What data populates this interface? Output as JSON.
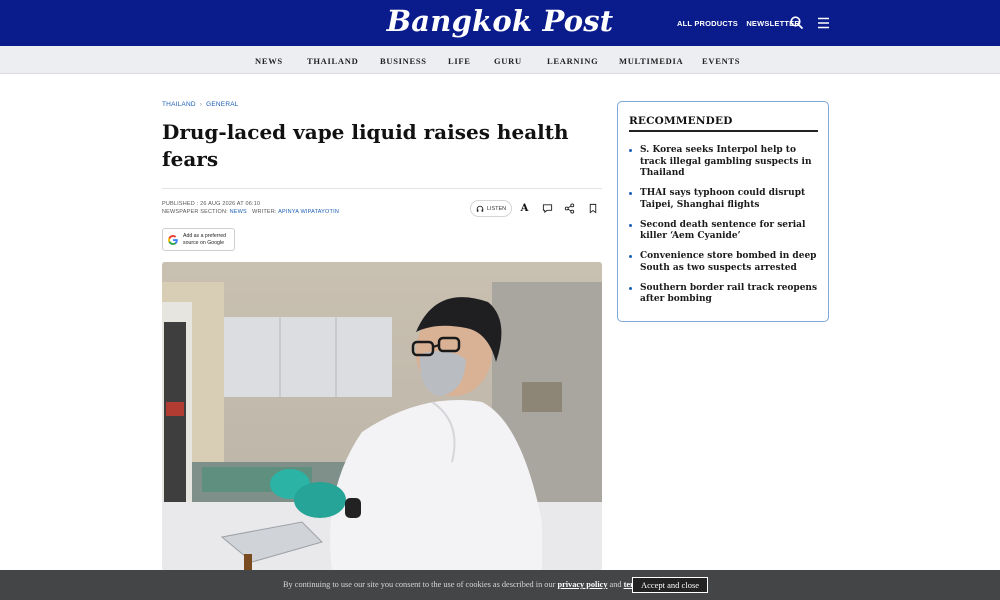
{
  "header": {
    "logo": "Bangkok Post",
    "all_products": "ALL PRODUCTS",
    "newsletter": "NEWSLETTER",
    "icons": [
      "search-icon",
      "menu-icon"
    ]
  },
  "nav": [
    "NEWS",
    "THAILAND",
    "BUSINESS",
    "LIFE",
    "GURU",
    "LEARNING",
    "MULTIMEDIA",
    "EVENTS"
  ],
  "breadcrumb": [
    "THAILAND",
    "GENERAL"
  ],
  "article": {
    "headline": "Drug-laced vape liquid raises health fears",
    "published_label": "PUBLISHED : 26 AUG 2026 AT 06:10",
    "section_label": "NEWSPAPER SECTION:",
    "section_value": "NEWS",
    "writer_label": "WRITER:",
    "writer_value": "APINYA WIPATAYOTIN",
    "listen": "LISTEN",
    "font_size_glyph": "A",
    "google_badge_line1": "Add as a preferred",
    "google_badge_line2": "source on Google"
  },
  "recommended": {
    "title": "RECOMMENDED",
    "items": [
      "S. Korea seeks Interpol help to track illegal gambling suspects in Thailand",
      "THAI says typhoon could disrupt Taipei, Shanghai flights",
      "Second death sentence for serial killer ‘Aem Cyanide’",
      "Convenience store bombed in deep South as two suspects arrested",
      "Southern border rail track reopens after bombing"
    ]
  },
  "cookie": {
    "text_before": "By continuing to use our site you consent to the use of cookies as described in our",
    "privacy_link": "privacy policy",
    "and": "and",
    "terms_link": "terms",
    "accept": "Accept and close"
  },
  "colors": {
    "header_bg": "#0a1b8c",
    "nav_bg": "#eceef1",
    "link_blue": "#1c5fb5",
    "cookie_bg": "#444546"
  }
}
